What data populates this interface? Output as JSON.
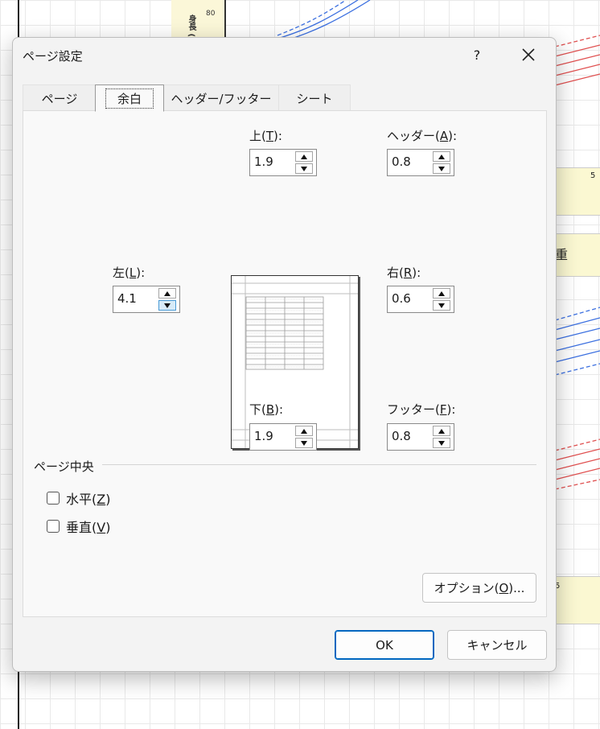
{
  "background": {
    "tick_80": "80",
    "y_unit": "身長 (cm)",
    "band1_text": "5",
    "band2_text": "重",
    "band3_text": "5"
  },
  "dialog": {
    "title": "ページ設定",
    "help_label": "?",
    "tabs": [
      {
        "label": "ページ"
      },
      {
        "label": "余白"
      },
      {
        "label": "ヘッダー/フッター"
      },
      {
        "label": "シート"
      }
    ],
    "active_tab": "余白",
    "margins": {
      "top": {
        "label": "上(",
        "key": "T",
        "suffix": "):",
        "value": "1.9"
      },
      "header": {
        "label": "ヘッダー(",
        "key": "A",
        "suffix": "):",
        "value": "0.8"
      },
      "left": {
        "label": "左(",
        "key": "L",
        "suffix": "):",
        "value": "4.1"
      },
      "right": {
        "label": "右(",
        "key": "R",
        "suffix": "):",
        "value": "0.6"
      },
      "bottom": {
        "label": "下(",
        "key": "B",
        "suffix": "):",
        "value": "1.9"
      },
      "footer": {
        "label": "フッター(",
        "key": "F",
        "suffix": "):",
        "value": "0.8"
      }
    },
    "center_section": {
      "label": "ページ中央",
      "horizontal": {
        "label": "水平(",
        "key": "Z",
        "suffix": ")",
        "checked": false
      },
      "vertical": {
        "label": "垂直(",
        "key": "V",
        "suffix": ")",
        "checked": false
      }
    },
    "options_button": {
      "label": "オプション(",
      "key": "O",
      "suffix": ")..."
    },
    "ok_button": "OK",
    "cancel_button": "キャンセル"
  },
  "colors": {
    "accent": "#0067c0",
    "dialog_bg": "#f3f3f3",
    "panel_bg": "#f9f9f9"
  }
}
